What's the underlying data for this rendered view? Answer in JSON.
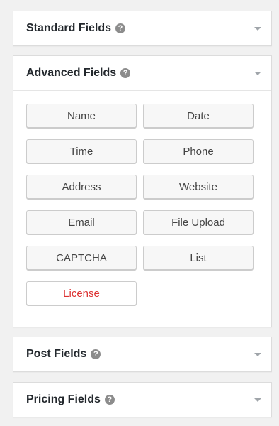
{
  "panels": {
    "standard": {
      "title": "Standard Fields",
      "help": "?"
    },
    "advanced": {
      "title": "Advanced Fields",
      "help": "?",
      "buttons": [
        "Name",
        "Date",
        "Time",
        "Phone",
        "Address",
        "Website",
        "Email",
        "File Upload",
        "CAPTCHA",
        "List",
        "License"
      ]
    },
    "post": {
      "title": "Post Fields",
      "help": "?"
    },
    "pricing": {
      "title": "Pricing Fields",
      "help": "?"
    }
  },
  "colors": {
    "background": "#f1f1f1",
    "panel": "#ffffff",
    "button": "#f7f7f7",
    "license_text": "#dc3232",
    "help_icon": "#8c8c8c"
  },
  "icons": {
    "help": "question-circle-icon",
    "toggle": "chevron-down-icon"
  }
}
